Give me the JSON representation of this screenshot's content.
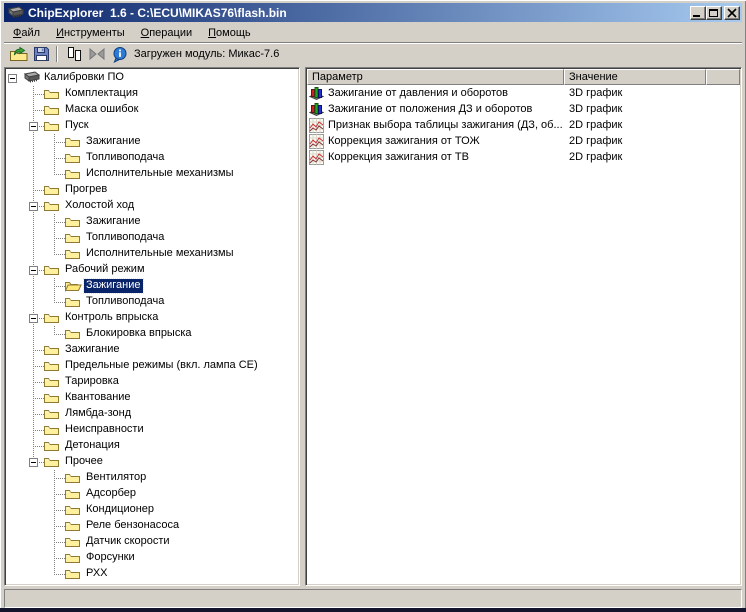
{
  "window": {
    "title": "ChipExplorer  1.6 - C:\\ECU\\MIKAS76\\flash.bin",
    "controls": {
      "minimize": "minimize",
      "maximize": "maximize",
      "close": "close"
    }
  },
  "colors": {
    "titlebar_start": "#0A246A",
    "titlebar_end": "#A6CAF0",
    "selection": "#0A246A",
    "chrome": "#D4D0C8",
    "folder_yellow": "#FFF0A0"
  },
  "menu": {
    "items": [
      "Файл",
      "Инструменты",
      "Операции",
      "Помощь"
    ]
  },
  "toolbar": {
    "status_label": "Загружен модуль: Микас-7.6",
    "items": [
      {
        "type": "button",
        "icon": "open"
      },
      {
        "type": "button",
        "icon": "save"
      },
      {
        "type": "separator"
      },
      {
        "type": "button",
        "icon": "compare"
      },
      {
        "type": "button",
        "icon": "merge",
        "disabled": true
      },
      {
        "type": "button",
        "icon": "info"
      }
    ]
  },
  "tree": {
    "nodes": [
      {
        "label": "Калибровки ПО",
        "depth": 0,
        "icon": "chip",
        "expander": true
      },
      {
        "label": "Комплектация",
        "depth": 1,
        "icon": "folder"
      },
      {
        "label": "Маска ошибок",
        "depth": 1,
        "icon": "folder"
      },
      {
        "label": "Пуск",
        "depth": 1,
        "icon": "folder",
        "expander": true
      },
      {
        "label": "Зажигание",
        "depth": 2,
        "icon": "folder"
      },
      {
        "label": "Топливоподача",
        "depth": 2,
        "icon": "folder"
      },
      {
        "label": "Исполнительные механизмы",
        "depth": 2,
        "icon": "folder"
      },
      {
        "label": "Прогрев",
        "depth": 1,
        "icon": "folder"
      },
      {
        "label": "Холостой ход",
        "depth": 1,
        "icon": "folder",
        "expander": true
      },
      {
        "label": "Зажигание",
        "depth": 2,
        "icon": "folder"
      },
      {
        "label": "Топливоподача",
        "depth": 2,
        "icon": "folder"
      },
      {
        "label": "Исполнительные механизмы",
        "depth": 2,
        "icon": "folder"
      },
      {
        "label": "Рабочий режим",
        "depth": 1,
        "icon": "folder",
        "expander": true
      },
      {
        "label": "Зажигание",
        "depth": 2,
        "icon": "folder-open",
        "selected": true
      },
      {
        "label": "Топливоподача",
        "depth": 2,
        "icon": "folder"
      },
      {
        "label": "Контроль впрыска",
        "depth": 1,
        "icon": "folder",
        "expander": true
      },
      {
        "label": "Блокировка впрыска",
        "depth": 2,
        "icon": "folder"
      },
      {
        "label": "Зажигание",
        "depth": 1,
        "icon": "folder"
      },
      {
        "label": "Предельные режимы (вкл. лампа CE)",
        "depth": 1,
        "icon": "folder"
      },
      {
        "label": "Тарировка",
        "depth": 1,
        "icon": "folder"
      },
      {
        "label": "Квантование",
        "depth": 1,
        "icon": "folder"
      },
      {
        "label": "Лямбда-зонд",
        "depth": 1,
        "icon": "folder"
      },
      {
        "label": "Неисправности",
        "depth": 1,
        "icon": "folder"
      },
      {
        "label": "Детонация",
        "depth": 1,
        "icon": "folder"
      },
      {
        "label": "Прочее",
        "depth": 1,
        "icon": "folder",
        "expander": true
      },
      {
        "label": "Вентилятор",
        "depth": 2,
        "icon": "folder"
      },
      {
        "label": "Адсорбер",
        "depth": 2,
        "icon": "folder"
      },
      {
        "label": "Кондиционер",
        "depth": 2,
        "icon": "folder"
      },
      {
        "label": "Реле бензонасоса",
        "depth": 2,
        "icon": "folder"
      },
      {
        "label": "Датчик скорости",
        "depth": 2,
        "icon": "folder"
      },
      {
        "label": "Форсунки",
        "depth": 2,
        "icon": "folder"
      },
      {
        "label": "РХХ",
        "depth": 2,
        "icon": "folder"
      }
    ]
  },
  "table": {
    "columns": [
      "Параметр",
      "Значение"
    ],
    "rows": [
      {
        "icon": "chart-3d",
        "param": "Зажигание от давления и оборотов",
        "value": "3D график"
      },
      {
        "icon": "chart-3d",
        "param": "Зажигание от положения ДЗ и оборотов",
        "value": "3D график"
      },
      {
        "icon": "chart-2d",
        "param": "Признак выбора таблицы зажигания (ДЗ, об...",
        "value": "2D график"
      },
      {
        "icon": "chart-2d",
        "param": "Коррекция зажигания от ТОЖ",
        "value": "2D график"
      },
      {
        "icon": "chart-2d",
        "param": "Коррекция зажигания от ТВ",
        "value": "2D график"
      }
    ]
  }
}
